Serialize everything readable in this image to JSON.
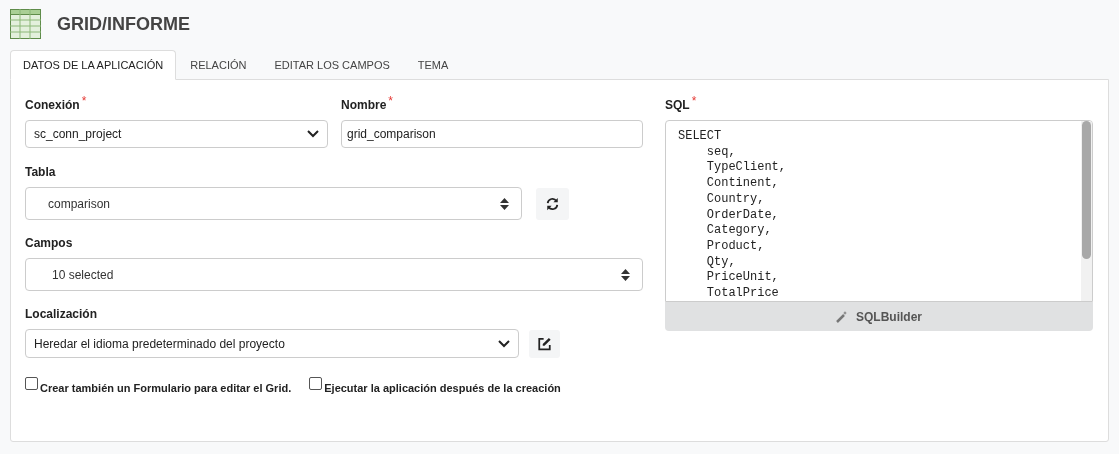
{
  "header": {
    "title": "GRID/INFORME"
  },
  "tabs": [
    {
      "label": "DATOS DE LA APLICACIÓN",
      "selected": true
    },
    {
      "label": "RELACIÓN",
      "selected": false
    },
    {
      "label": "EDITAR LOS CAMPOS",
      "selected": false
    },
    {
      "label": "TEMA",
      "selected": false
    }
  ],
  "conexion": {
    "label": "Conexión",
    "required_mark": "*",
    "value": "sc_conn_project"
  },
  "nombre": {
    "label": "Nombre",
    "required_mark": "*",
    "value": "grid_comparison"
  },
  "tabla": {
    "label": "Tabla",
    "value": "comparison"
  },
  "campos": {
    "label": "Campos",
    "value": "10 selected"
  },
  "localizacion": {
    "label": "Localización",
    "value": "Heredar el idioma predeterminado del proyecto"
  },
  "checkboxes": [
    {
      "label": "Crear también un Formulario para editar el Grid.",
      "checked": false
    },
    {
      "label": "Ejecutar la aplicación después de la creación",
      "checked": false
    }
  ],
  "sql": {
    "label": "SQL",
    "required_mark": "*",
    "lines": [
      "SELECT",
      "    seq,",
      "    TypeClient,",
      "    Continent,",
      "    Country,",
      "    OrderDate,",
      "    Category,",
      "    Product,",
      "    Qty,",
      "    PriceUnit,",
      "    TotalPrice"
    ],
    "button": "SQLBuilder"
  }
}
